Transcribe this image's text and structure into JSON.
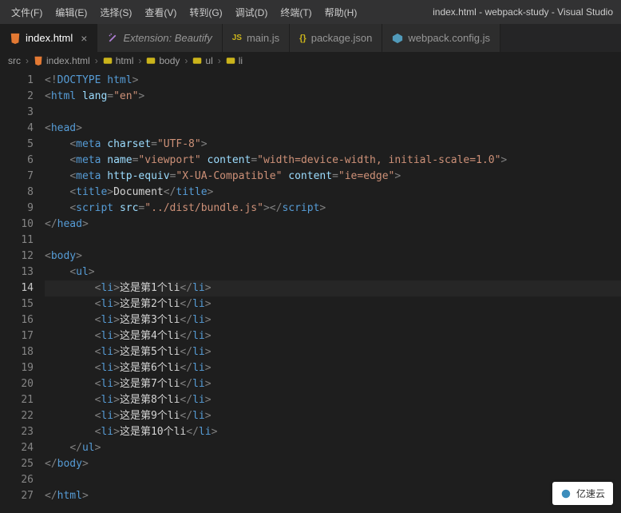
{
  "menu": {
    "file": "文件(F)",
    "edit": "编辑(E)",
    "select": "选择(S)",
    "view": "查看(V)",
    "goto": "转到(G)",
    "debug": "调试(D)",
    "terminal": "终端(T)",
    "help": "帮助(H)",
    "title": "index.html - webpack-study - Visual Studio"
  },
  "tabs": [
    {
      "label": "index.html",
      "icon": "html-icon",
      "active": true,
      "modified": false,
      "close": "×"
    },
    {
      "label": "Extension: Beautify",
      "icon": "wand-icon",
      "active": false,
      "italic": true
    },
    {
      "label": "main.js",
      "icon": "js-icon",
      "prefix": "JS"
    },
    {
      "label": "package.json",
      "icon": "json-icon",
      "prefix": "{}"
    },
    {
      "label": "webpack.config.js",
      "icon": "webpack-icon"
    }
  ],
  "breadcrumb": {
    "src": "src",
    "sep": "›",
    "file": "index.html",
    "path": [
      "html",
      "body",
      "ul",
      "li"
    ]
  },
  "watermark": "亿速云",
  "code": {
    "indent": "    ",
    "activeLine": 14,
    "lines": [
      {
        "n": 1,
        "indent": 0,
        "type": "doctype",
        "text": "DOCTYPE html"
      },
      {
        "n": 2,
        "indent": 0,
        "type": "open",
        "tag": "html",
        "attrs": [
          [
            "lang",
            "\"en\""
          ]
        ]
      },
      {
        "n": 3,
        "indent": 0,
        "type": "blank"
      },
      {
        "n": 4,
        "indent": 0,
        "type": "open",
        "tag": "head"
      },
      {
        "n": 5,
        "indent": 1,
        "type": "selfclose",
        "tag": "meta",
        "attrs": [
          [
            "charset",
            "\"UTF-8\""
          ]
        ]
      },
      {
        "n": 6,
        "indent": 1,
        "type": "selfclose",
        "tag": "meta",
        "attrs": [
          [
            "name",
            "\"viewport\""
          ],
          [
            "content",
            "\"width=device-width, initial-scale=1.0\""
          ]
        ]
      },
      {
        "n": 7,
        "indent": 1,
        "type": "selfclose",
        "tag": "meta",
        "attrs": [
          [
            "http-equiv",
            "\"X-UA-Compatible\""
          ],
          [
            "content",
            "\"ie=edge\""
          ]
        ]
      },
      {
        "n": 8,
        "indent": 1,
        "type": "pair",
        "tag": "title",
        "inner": "Document"
      },
      {
        "n": 9,
        "indent": 1,
        "type": "pair",
        "tag": "script",
        "attrs": [
          [
            "src",
            "\"../dist/bundle.js\""
          ]
        ],
        "inner": ""
      },
      {
        "n": 10,
        "indent": 0,
        "type": "close",
        "tag": "head"
      },
      {
        "n": 11,
        "indent": 0,
        "type": "blank"
      },
      {
        "n": 12,
        "indent": 0,
        "type": "open",
        "tag": "body"
      },
      {
        "n": 13,
        "indent": 1,
        "type": "open",
        "tag": "ul"
      },
      {
        "n": 14,
        "indent": 2,
        "type": "pair",
        "tag": "li",
        "inner": "这是第1个li",
        "cursor": true
      },
      {
        "n": 15,
        "indent": 2,
        "type": "pair",
        "tag": "li",
        "inner": "这是第2个li"
      },
      {
        "n": 16,
        "indent": 2,
        "type": "pair",
        "tag": "li",
        "inner": "这是第3个li"
      },
      {
        "n": 17,
        "indent": 2,
        "type": "pair",
        "tag": "li",
        "inner": "这是第4个li"
      },
      {
        "n": 18,
        "indent": 2,
        "type": "pair",
        "tag": "li",
        "inner": "这是第5个li"
      },
      {
        "n": 19,
        "indent": 2,
        "type": "pair",
        "tag": "li",
        "inner": "这是第6个li"
      },
      {
        "n": 20,
        "indent": 2,
        "type": "pair",
        "tag": "li",
        "inner": "这是第7个li"
      },
      {
        "n": 21,
        "indent": 2,
        "type": "pair",
        "tag": "li",
        "inner": "这是第8个li"
      },
      {
        "n": 22,
        "indent": 2,
        "type": "pair",
        "tag": "li",
        "inner": "这是第9个li"
      },
      {
        "n": 23,
        "indent": 2,
        "type": "pair",
        "tag": "li",
        "inner": "这是第10个li"
      },
      {
        "n": 24,
        "indent": 1,
        "type": "close",
        "tag": "ul"
      },
      {
        "n": 25,
        "indent": 0,
        "type": "close",
        "tag": "body"
      },
      {
        "n": 26,
        "indent": 0,
        "type": "blank"
      },
      {
        "n": 27,
        "indent": 0,
        "type": "close",
        "tag": "html"
      }
    ]
  }
}
